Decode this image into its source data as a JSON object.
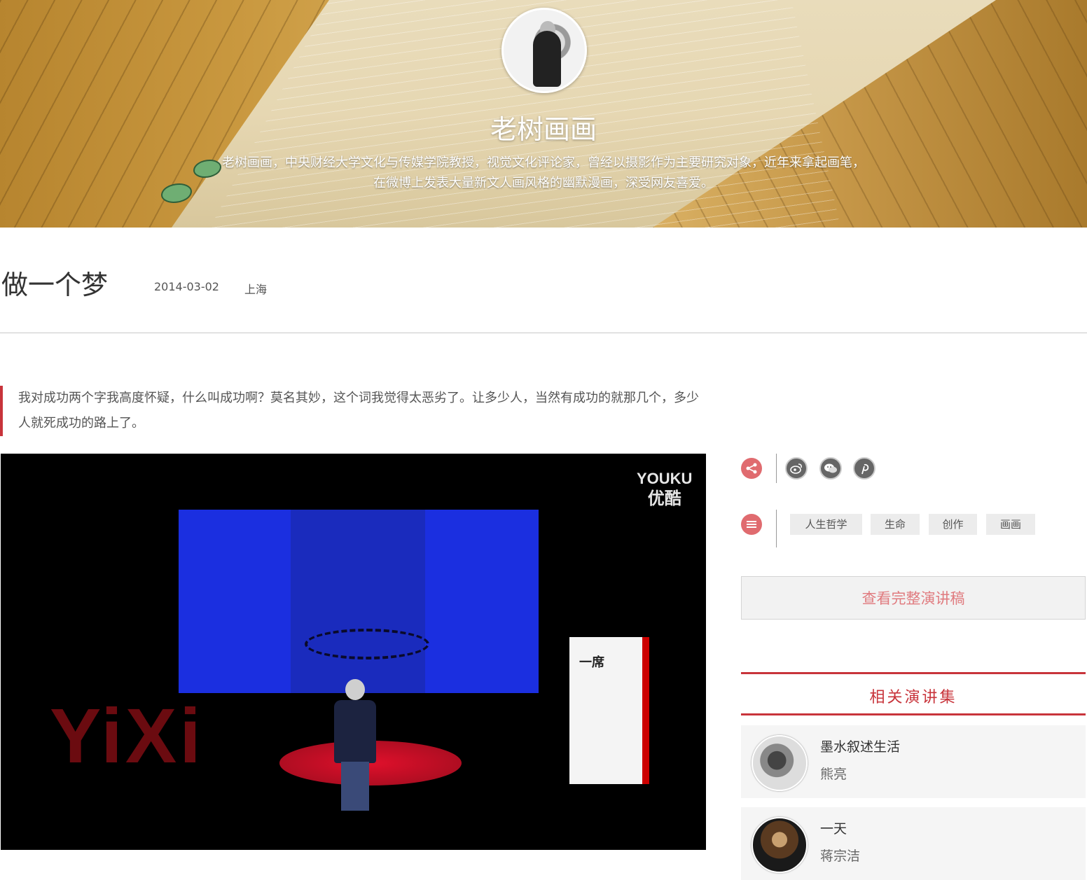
{
  "hero": {
    "name": "老树画画",
    "description": "老树画画，中央财经大学文化与传媒学院教授，视觉文化评论家，曾经以摄影作为主要研究对象，近年来拿起画笔，在微博上发表大量新文人画风格的幽默漫画，深受网友喜爱。"
  },
  "talk": {
    "title": "做一个梦",
    "date": "2014-03-02",
    "location": "上海",
    "quote": "我对成功两个字我高度怀疑，什么叫成功啊？莫名其妙，这个词我觉得太恶劣了。让多少人，当然有成功的就那几个，多少人就死成功的路上了。"
  },
  "video": {
    "watermark_en": "YOUKU",
    "watermark_cn": "优酷",
    "stage_logo": "YiXi",
    "sign_title": "一席"
  },
  "share": {
    "icons": [
      "share-icon",
      "weibo-icon",
      "wechat-icon",
      "pinterest-icon"
    ]
  },
  "tags": {
    "icon": "list-icon",
    "items": [
      "人生哲学",
      "生命",
      "创作",
      "画画"
    ]
  },
  "full_transcript_label": "查看完整演讲稿",
  "related": {
    "heading": "相关演讲集",
    "items": [
      {
        "title": "墨水叙述生活",
        "author": "熊亮"
      },
      {
        "title": "一天",
        "author": "蒋宗洁"
      }
    ]
  },
  "colors": {
    "accent": "#c8343b",
    "accent_light": "#e06b6f"
  }
}
